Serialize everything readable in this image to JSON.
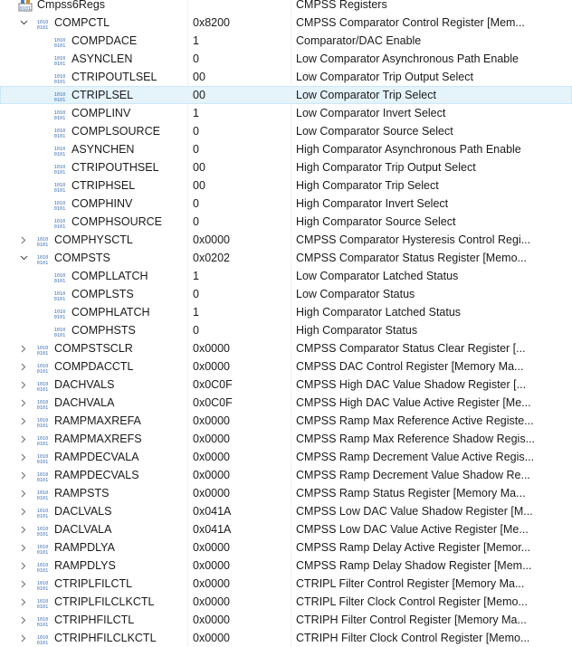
{
  "root": {
    "name": "Cmpss6Regs",
    "description": "CMPSS Registers",
    "icon": "struct-icon"
  },
  "rows": [
    {
      "name": "COMPCTL",
      "value": "0x8200",
      "desc": "CMPSS Comparator Control Register [Mem...",
      "level": 1,
      "state": "expanded"
    },
    {
      "name": "COMPDACE",
      "value": "1",
      "desc": "Comparator/DAC Enable",
      "level": 2,
      "state": "leaf"
    },
    {
      "name": "ASYNCLEN",
      "value": "0",
      "desc": "Low Comparator Asynchronous Path Enable",
      "level": 2,
      "state": "leaf"
    },
    {
      "name": "CTRIPOUTLSEL",
      "value": "00",
      "desc": "Low Comparator Trip Output Select",
      "level": 2,
      "state": "leaf"
    },
    {
      "name": "CTRIPLSEL",
      "value": "00",
      "desc": "Low Comparator Trip Select",
      "level": 2,
      "state": "leaf",
      "selected": true
    },
    {
      "name": "COMPLINV",
      "value": "1",
      "desc": "Low Comparator Invert Select",
      "level": 2,
      "state": "leaf"
    },
    {
      "name": "COMPLSOURCE",
      "value": "0",
      "desc": "Low Comparator Source Select",
      "level": 2,
      "state": "leaf"
    },
    {
      "name": "ASYNCHEN",
      "value": "0",
      "desc": "High Comparator Asynchronous Path Enable",
      "level": 2,
      "state": "leaf"
    },
    {
      "name": "CTRIPOUTHSEL",
      "value": "00",
      "desc": "High Comparator Trip Output Select",
      "level": 2,
      "state": "leaf"
    },
    {
      "name": "CTRIPHSEL",
      "value": "00",
      "desc": "High Comparator Trip Select",
      "level": 2,
      "state": "leaf"
    },
    {
      "name": "COMPHINV",
      "value": "0",
      "desc": "High Comparator Invert Select",
      "level": 2,
      "state": "leaf"
    },
    {
      "name": "COMPHSOURCE",
      "value": "0",
      "desc": "High Comparator Source Select",
      "level": 2,
      "state": "leaf"
    },
    {
      "name": "COMPHYSCTL",
      "value": "0x0000",
      "desc": "CMPSS Comparator Hysteresis Control Regi...",
      "level": 1,
      "state": "collapsed"
    },
    {
      "name": "COMPSTS",
      "value": "0x0202",
      "desc": "CMPSS Comparator Status Register [Memo...",
      "level": 1,
      "state": "expanded"
    },
    {
      "name": "COMPLLATCH",
      "value": "1",
      "desc": "Low Comparator Latched Status",
      "level": 2,
      "state": "leaf"
    },
    {
      "name": "COMPLSTS",
      "value": "0",
      "desc": "Low Comparator Status",
      "level": 2,
      "state": "leaf"
    },
    {
      "name": "COMPHLATCH",
      "value": "1",
      "desc": "High Comparator Latched Status",
      "level": 2,
      "state": "leaf"
    },
    {
      "name": "COMPHSTS",
      "value": "0",
      "desc": "High Comparator Status",
      "level": 2,
      "state": "leaf"
    },
    {
      "name": "COMPSTSCLR",
      "value": "0x0000",
      "desc": "CMPSS Comparator Status Clear Register [...",
      "level": 1,
      "state": "collapsed"
    },
    {
      "name": "COMPDACCTL",
      "value": "0x0000",
      "desc": "CMPSS DAC Control Register [Memory Ma...",
      "level": 1,
      "state": "collapsed"
    },
    {
      "name": "DACHVALS",
      "value": "0x0C0F",
      "desc": "CMPSS High DAC Value Shadow Register [...",
      "level": 1,
      "state": "collapsed"
    },
    {
      "name": "DACHVALA",
      "value": "0x0C0F",
      "desc": "CMPSS High DAC Value Active Register [Me...",
      "level": 1,
      "state": "collapsed"
    },
    {
      "name": "RAMPMAXREFA",
      "value": "0x0000",
      "desc": "CMPSS Ramp Max Reference Active Registe...",
      "level": 1,
      "state": "collapsed"
    },
    {
      "name": "RAMPMAXREFS",
      "value": "0x0000",
      "desc": "CMPSS Ramp Max Reference Shadow Regis...",
      "level": 1,
      "state": "collapsed"
    },
    {
      "name": "RAMPDECVALA",
      "value": "0x0000",
      "desc": "CMPSS Ramp Decrement Value Active Regis...",
      "level": 1,
      "state": "collapsed"
    },
    {
      "name": "RAMPDECVALS",
      "value": "0x0000",
      "desc": "CMPSS Ramp Decrement Value Shadow Re...",
      "level": 1,
      "state": "collapsed"
    },
    {
      "name": "RAMPSTS",
      "value": "0x0000",
      "desc": "CMPSS Ramp Status Register [Memory Ma...",
      "level": 1,
      "state": "collapsed"
    },
    {
      "name": "DACLVALS",
      "value": "0x041A",
      "desc": "CMPSS Low DAC Value Shadow Register [M...",
      "level": 1,
      "state": "collapsed"
    },
    {
      "name": "DACLVALA",
      "value": "0x041A",
      "desc": "CMPSS Low DAC Value Active Register [Me...",
      "level": 1,
      "state": "collapsed"
    },
    {
      "name": "RAMPDLYA",
      "value": "0x0000",
      "desc": "CMPSS Ramp Delay Active Register [Memor...",
      "level": 1,
      "state": "collapsed"
    },
    {
      "name": "RAMPDLYS",
      "value": "0x0000",
      "desc": "CMPSS Ramp Delay Shadow Register [Mem...",
      "level": 1,
      "state": "collapsed"
    },
    {
      "name": "CTRIPLFILCTL",
      "value": "0x0000",
      "desc": "CTRIPL Filter Control Register [Memory Ma...",
      "level": 1,
      "state": "collapsed"
    },
    {
      "name": "CTRIPLFILCLKCTL",
      "value": "0x0000",
      "desc": "CTRIPL Filter Clock Control Register [Memo...",
      "level": 1,
      "state": "collapsed"
    },
    {
      "name": "CTRIPHFILCTL",
      "value": "0x0000",
      "desc": "CTRIPH Filter Control Register [Memory Ma...",
      "level": 1,
      "state": "collapsed"
    },
    {
      "name": "CTRIPHFILCLKCTL",
      "value": "0x0000",
      "desc": "CTRIPH Filter Clock Control Register [Memo...",
      "level": 1,
      "state": "collapsed"
    }
  ],
  "icons": {
    "register": "register-bits-icon",
    "expanded": "chevron-down-icon",
    "collapsed": "chevron-right-icon"
  },
  "colors": {
    "selected_bg": "#e5f3fb",
    "icon_blue": "#3d6fb6",
    "text": "#1a1a1a"
  }
}
